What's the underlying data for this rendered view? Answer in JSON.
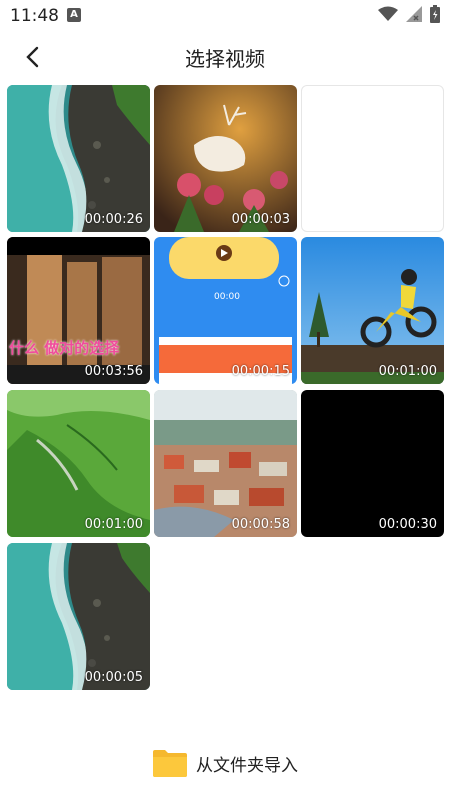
{
  "status": {
    "time": "11:48",
    "notification_icon": "a-icon"
  },
  "header": {
    "title": "选择视频",
    "back_icon": "chevron-left-icon"
  },
  "videos": [
    {
      "duration": "00:00:26",
      "thumbnail": "aerial-coastline"
    },
    {
      "duration": "00:00:03",
      "thumbnail": "deer-flowers"
    },
    {
      "duration": "",
      "thumbnail": "blank"
    },
    {
      "duration": "00:03:56",
      "thumbnail": "buildings-karaoke",
      "overlay_text": "什么 做对的选择"
    },
    {
      "duration": "00:00:15",
      "thumbnail": "app-screen",
      "overlay_text": "00:00"
    },
    {
      "duration": "00:01:00",
      "thumbnail": "motocross"
    },
    {
      "duration": "00:01:00",
      "thumbnail": "green-hills"
    },
    {
      "duration": "00:00:58",
      "thumbnail": "town-aerial"
    },
    {
      "duration": "00:00:30",
      "thumbnail": "black"
    },
    {
      "duration": "00:00:05",
      "thumbnail": "aerial-coastline"
    }
  ],
  "footer": {
    "import_label": "从文件夹导入",
    "folder_icon": "folder-icon",
    "folder_color": "#F5B82E"
  }
}
